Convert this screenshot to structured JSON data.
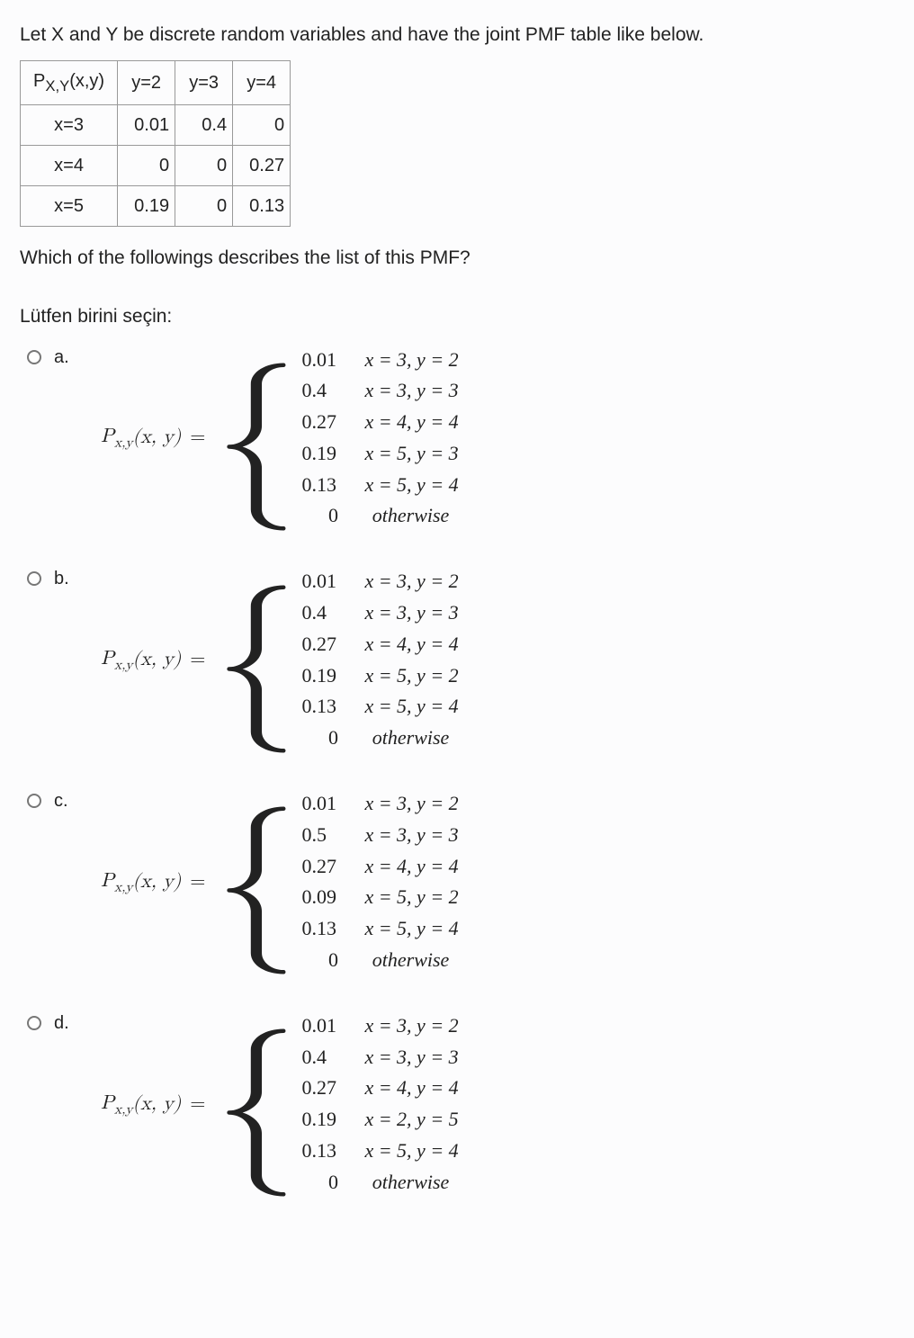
{
  "question": "Let X and Y be discrete random variables and have the joint PMF table like below.",
  "table": {
    "corner": "P",
    "corner_sub": "X,Y",
    "corner_args": "(x,y)",
    "cols": [
      "y=2",
      "y=3",
      "y=4"
    ],
    "rows": [
      {
        "label": "x=3",
        "cells": [
          "0.01",
          "0.4",
          "0"
        ]
      },
      {
        "label": "x=4",
        "cells": [
          "0",
          "0",
          "0.27"
        ]
      },
      {
        "label": "x=5",
        "cells": [
          "0.19",
          "0",
          "0.13"
        ]
      }
    ]
  },
  "sub_question": "Which of the followings describes the list of this PMF?",
  "choose_one": "Lütfen birini seçin:",
  "fn_label": {
    "P": "P",
    "sub": "x,y",
    "args": "(x, y)",
    "eq": "="
  },
  "options": [
    {
      "key": "a.",
      "cases": [
        {
          "v": "0.01",
          "c": "x = 3, y = 2"
        },
        {
          "v": "0.4",
          "c": "x = 3, y = 3"
        },
        {
          "v": "0.27",
          "c": "x = 4, y = 4"
        },
        {
          "v": "0.19",
          "c": "x = 5, y = 3"
        },
        {
          "v": "0.13",
          "c": "x = 5, y = 4"
        },
        {
          "v": "0",
          "c": "otherwise",
          "otherwise": true
        }
      ]
    },
    {
      "key": "b.",
      "cases": [
        {
          "v": "0.01",
          "c": "x = 3, y = 2"
        },
        {
          "v": "0.4",
          "c": "x = 3, y = 3"
        },
        {
          "v": "0.27",
          "c": "x = 4, y = 4"
        },
        {
          "v": "0.19",
          "c": "x = 5, y = 2"
        },
        {
          "v": "0.13",
          "c": "x = 5, y = 4"
        },
        {
          "v": "0",
          "c": "otherwise",
          "otherwise": true
        }
      ]
    },
    {
      "key": "c.",
      "cases": [
        {
          "v": "0.01",
          "c": "x = 3, y = 2"
        },
        {
          "v": "0.5",
          "c": "x = 3, y = 3"
        },
        {
          "v": "0.27",
          "c": "x = 4, y = 4"
        },
        {
          "v": "0.09",
          "c": "x = 5, y = 2"
        },
        {
          "v": "0.13",
          "c": "x = 5, y = 4"
        },
        {
          "v": "0",
          "c": "otherwise",
          "otherwise": true
        }
      ]
    },
    {
      "key": "d.",
      "cases": [
        {
          "v": "0.01",
          "c": "x = 3, y = 2"
        },
        {
          "v": "0.4",
          "c": "x = 3, y = 3"
        },
        {
          "v": "0.27",
          "c": "x = 4, y = 4"
        },
        {
          "v": "0.19",
          "c": "x = 2, y = 5"
        },
        {
          "v": "0.13",
          "c": "x = 5, y = 4"
        },
        {
          "v": "0",
          "c": "otherwise",
          "otherwise": true
        }
      ]
    }
  ]
}
